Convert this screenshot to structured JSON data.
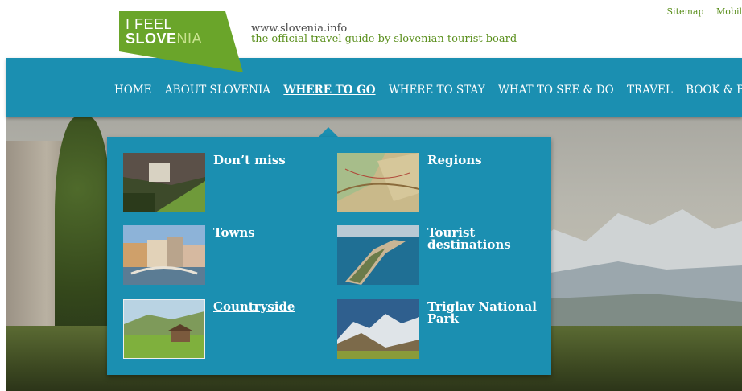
{
  "logo": {
    "line1": "I FEEL",
    "line2_bold": "SLOVE",
    "line2_thin": "NIA"
  },
  "site": {
    "url": "www.slovenia.info",
    "tagline": "the official travel guide by slovenian tourist board"
  },
  "top_links": [
    "Sitemap",
    "Mobil"
  ],
  "nav": [
    "HOME",
    "ABOUT SLOVENIA",
    "WHERE TO GO",
    "WHERE TO STAY",
    "WHAT TO SEE & DO",
    "TRAVEL",
    "BOOK & BUY"
  ],
  "nav_active": "WHERE TO GO",
  "dropdown": {
    "items": [
      {
        "label": "Don’t miss"
      },
      {
        "label": "Regions"
      },
      {
        "label": "Towns"
      },
      {
        "label": "Tourist destinations"
      },
      {
        "label": "Countryside"
      },
      {
        "label": "Triglav National Park"
      }
    ]
  },
  "colors": {
    "nav_blue": "#1b8fb1",
    "logo_green": "#6aa52a",
    "tagline_green": "#5a8f1c"
  }
}
